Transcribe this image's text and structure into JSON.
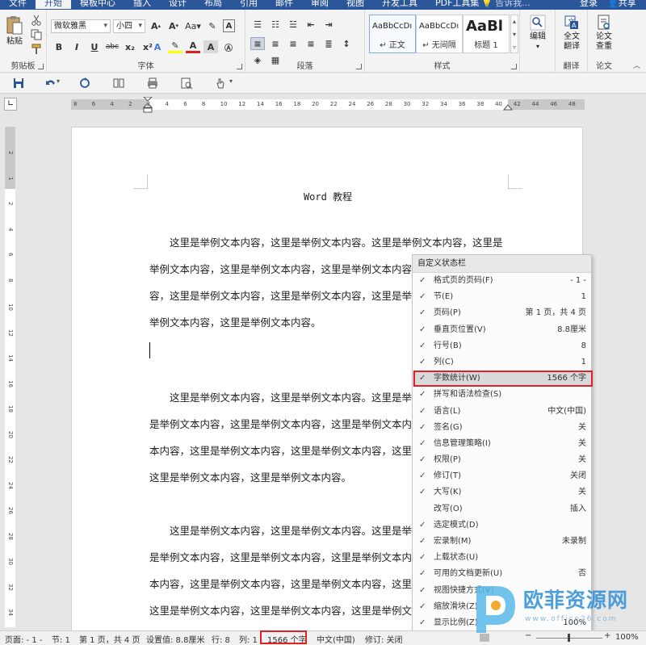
{
  "tabs": [
    "文件",
    "开始",
    "模板中心",
    "插入",
    "设计",
    "布局",
    "引用",
    "邮件",
    "审阅",
    "视图",
    "开发工具",
    "PDF工具集"
  ],
  "active_tab": "开始",
  "tell_me": "告诉我...",
  "login": "登录",
  "share": "共享",
  "ribbon": {
    "clipboard": {
      "label": "剪贴板",
      "paste": "粘贴"
    },
    "font": {
      "label": "字体",
      "name": "微软雅黑",
      "size": "小四",
      "format_items": [
        "B",
        "I",
        "U",
        "abc",
        "x₂",
        "x²"
      ]
    },
    "paragraph": {
      "label": "段落"
    },
    "styles": {
      "label": "样式",
      "items": [
        {
          "sample": "AaBbCcDı",
          "name": "↵ 正文"
        },
        {
          "sample": "AaBbCcDı",
          "name": "↵ 无间隔"
        },
        {
          "sample": "AaBl",
          "name": "标题 1"
        }
      ]
    },
    "editing": {
      "label": "编辑"
    },
    "translate": {
      "btn1": "全文",
      "btn2": "翻译",
      "label": "翻译"
    },
    "paper": {
      "btn1": "论文",
      "btn2": "查重",
      "label": "论文"
    }
  },
  "ruler": {
    "h_ticks": [
      "8",
      "6",
      "4",
      "2",
      "2",
      "4",
      "6",
      "8",
      "10",
      "12",
      "14",
      "16",
      "18",
      "20",
      "22",
      "24",
      "26",
      "28",
      "30",
      "32",
      "34",
      "36",
      "38",
      "40",
      "42",
      "44",
      "46",
      "48"
    ],
    "v_ticks": [
      "2",
      "1",
      "2",
      "4",
      "6",
      "8",
      "10",
      "12",
      "14",
      "16",
      "18",
      "20",
      "22",
      "24",
      "26",
      "28",
      "30",
      "32",
      "34"
    ]
  },
  "document": {
    "title": "Word 教程",
    "paragraphs": [
      [
        "这里是举例文本内容，这里是举例文本内容。这里是举例文本内容，这里是",
        "举例文本内容，这里是举例文本内容，这里是举例文本内容，这里是举例文本内",
        "容，这里是举例文本内容，这里是举例文本内容，这里是举例文本内容，这里是",
        "举例文本内容，这里是举例文本内容。"
      ],
      [
        "这里是举例文本内容，这里是举例文本内容。这里是举例文本内容，这里",
        "是举例文本内容，这里是举例文本内容，这里是举例文本内容，这里是举例文",
        "本内容，这里是举例文本内容，这里是举例文本内容，这里是举例文本内容，",
        "这里是举例文本内容，这里是举例文本内容。"
      ],
      [
        "这里是举例文本内容，这里是举例文本内容。这里是举例文本内容，这里",
        "是举例文本内容，这里是举例文本内容，这里是举例文本内容，这里是举例文",
        "本内容，这里是举例文本内容，这里是举例文本内容，这里是举例文本内容，",
        "这里是举例文本内容，这里是举例文本内容，这里是举例文本内容，这里是"
      ]
    ]
  },
  "context_menu": {
    "title": "自定义状态栏",
    "items": [
      {
        "checked": true,
        "label": "格式页的页码(F)",
        "value": "- 1 -"
      },
      {
        "checked": true,
        "label": "节(E)",
        "value": "1"
      },
      {
        "checked": true,
        "label": "页码(P)",
        "value": "第 1 页，共 4 页"
      },
      {
        "checked": true,
        "label": "垂直页位置(V)",
        "value": "8.8厘米"
      },
      {
        "checked": true,
        "label": "行号(B)",
        "value": "8"
      },
      {
        "checked": true,
        "label": "列(C)",
        "value": "1"
      },
      {
        "checked": true,
        "label": "字数统计(W)",
        "value": "1566 个字",
        "highlight": true
      },
      {
        "checked": true,
        "label": "拼写和语法检查(S)",
        "value": ""
      },
      {
        "checked": true,
        "label": "语言(L)",
        "value": "中文(中国)"
      },
      {
        "checked": true,
        "label": "签名(G)",
        "value": "关"
      },
      {
        "checked": true,
        "label": "信息管理策略(I)",
        "value": "关"
      },
      {
        "checked": true,
        "label": "权限(P)",
        "value": "关"
      },
      {
        "checked": true,
        "label": "修订(T)",
        "value": "关闭"
      },
      {
        "checked": true,
        "label": "大写(K)",
        "value": "关"
      },
      {
        "checked": false,
        "label": "改写(O)",
        "value": "插入"
      },
      {
        "checked": true,
        "label": "选定模式(D)",
        "value": ""
      },
      {
        "checked": true,
        "label": "宏录制(M)",
        "value": "未录制"
      },
      {
        "checked": true,
        "label": "上载状态(U)",
        "value": ""
      },
      {
        "checked": true,
        "label": "可用的文档更新(U)",
        "value": "否"
      },
      {
        "checked": true,
        "label": "视图快捷方式(V)",
        "value": ""
      },
      {
        "checked": true,
        "label": "缩放滑块(Z)",
        "value": ""
      },
      {
        "checked": true,
        "label": "显示比例(Z)",
        "value": "100%"
      }
    ]
  },
  "statusbar": {
    "page_fmt": "页面: - 1 -",
    "section": "节: 1",
    "page": "第 1 页，共 4 页",
    "position": "设置值: 8.8厘米",
    "line": "行: 8",
    "col": "列: 1",
    "wordcount": "1566 个字",
    "language": "中文(中国)",
    "track": "修订: 关闭",
    "zoom": "100%"
  },
  "watermark": {
    "text": "欧菲资源网",
    "url": "www.office26.com"
  },
  "colors": {
    "brand": "#2b579a",
    "highlight_box": "#e0202a"
  }
}
